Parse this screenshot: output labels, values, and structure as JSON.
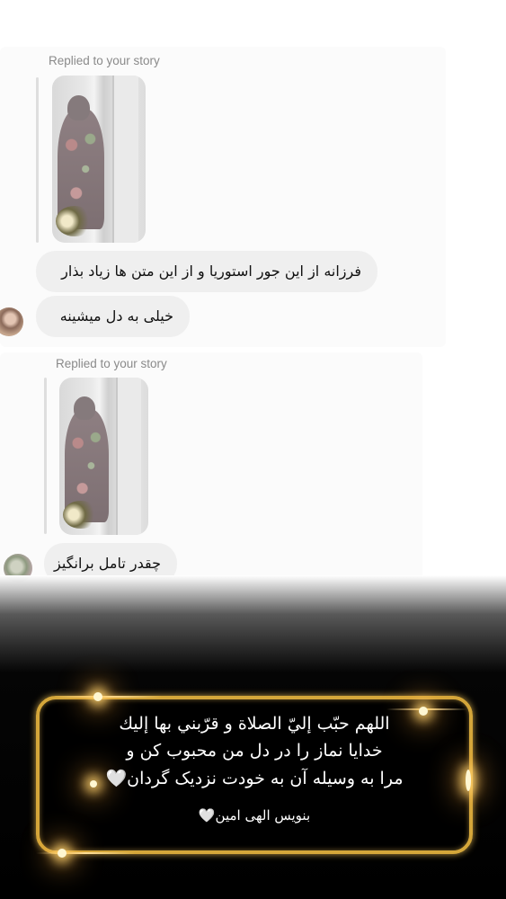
{
  "messages": [
    {
      "replied_label": "Replied to your story",
      "story_caption": "",
      "bubbles": [
        "فرزانه از این جور استوریا و از این متن ها زیاد بذار",
        "خیلی به دل میشینه"
      ]
    },
    {
      "replied_label": "Replied to your story",
      "story_caption": "",
      "bubbles": [
        "چقدر تامل برانگیز"
      ]
    }
  ],
  "banner": {
    "lines": [
      "اللهم حبّب إليّ الصلاة و قرّبني بها إليك",
      "خدایا نماز را در دل من محبوب کن و",
      "مرا به وسیله آن به خودت نزدیک گردان🤍"
    ],
    "signature": "بنویس الهی امین🤍"
  },
  "colors": {
    "bubble": "#efefef",
    "label": "#8a8a8a",
    "frame_gold": "#d4a63a"
  }
}
